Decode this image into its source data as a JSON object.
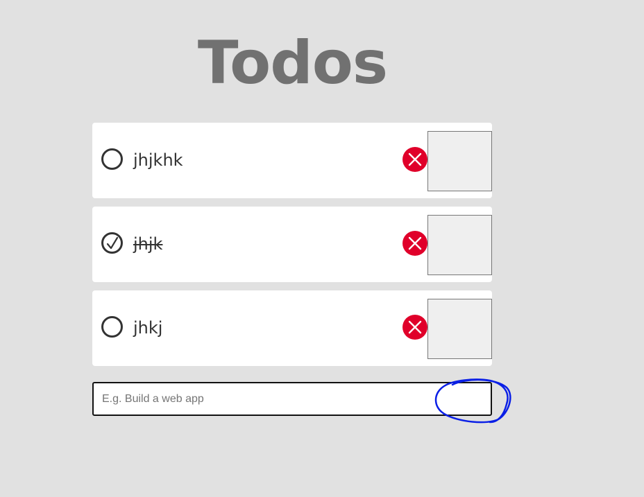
{
  "header": {
    "title": "Todos"
  },
  "todos": [
    {
      "text": "jhjkhk",
      "completed": false
    },
    {
      "text": "jhjk",
      "completed": true
    },
    {
      "text": "jhkj",
      "completed": false
    }
  ],
  "new_todo": {
    "value": "",
    "placeholder": "E.g. Build a web app",
    "submit_label": ""
  },
  "icons": {
    "check": "checkmark-icon",
    "delete": "close-icon"
  },
  "colors": {
    "background": "#e1e1e1",
    "title": "#717171",
    "delete": "#e0002a",
    "annotation": "#0a1fe6"
  }
}
